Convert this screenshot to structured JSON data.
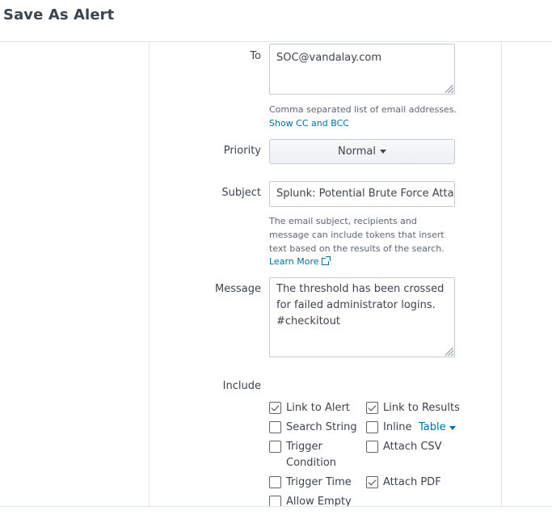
{
  "dialog": {
    "title": "Save As Alert"
  },
  "to": {
    "label": "To",
    "value": "SOC@vandalay.com",
    "help": "Comma separated list of email addresses.",
    "show_cc_link": "Show CC and BCC"
  },
  "priority": {
    "label": "Priority",
    "value": "Normal"
  },
  "subject": {
    "label": "Subject",
    "value": "Splunk: Potential Brute Force Attac",
    "help_lines": [
      "The email subject, recipients and",
      "message can include tokens that insert",
      "text based on the results of the search."
    ],
    "learn_more": "Learn More"
  },
  "message": {
    "label": "Message",
    "value": "The threshold has been crossed\nfor failed administrator logins.\n#checkitout"
  },
  "include": {
    "label": "Include",
    "options": {
      "link_to_alert": {
        "label": "Link to Alert",
        "checked": true
      },
      "link_to_results": {
        "label": "Link to Results",
        "checked": true
      },
      "search_string": {
        "label": "Search String",
        "checked": false
      },
      "inline": {
        "label": "Inline",
        "checked": false,
        "format": "Table"
      },
      "trigger_condition": {
        "label": "Trigger\nCondition",
        "checked": false
      },
      "attach_csv": {
        "label": "Attach CSV",
        "checked": false
      },
      "trigger_time": {
        "label": "Trigger Time",
        "checked": false
      },
      "attach_pdf": {
        "label": "Attach PDF",
        "checked": true
      },
      "allow_empty": {
        "label": "Allow Empty",
        "checked": false
      }
    }
  },
  "colors": {
    "link": "#006eaa",
    "text": "#3c444d",
    "border": "#c3cbd4"
  }
}
